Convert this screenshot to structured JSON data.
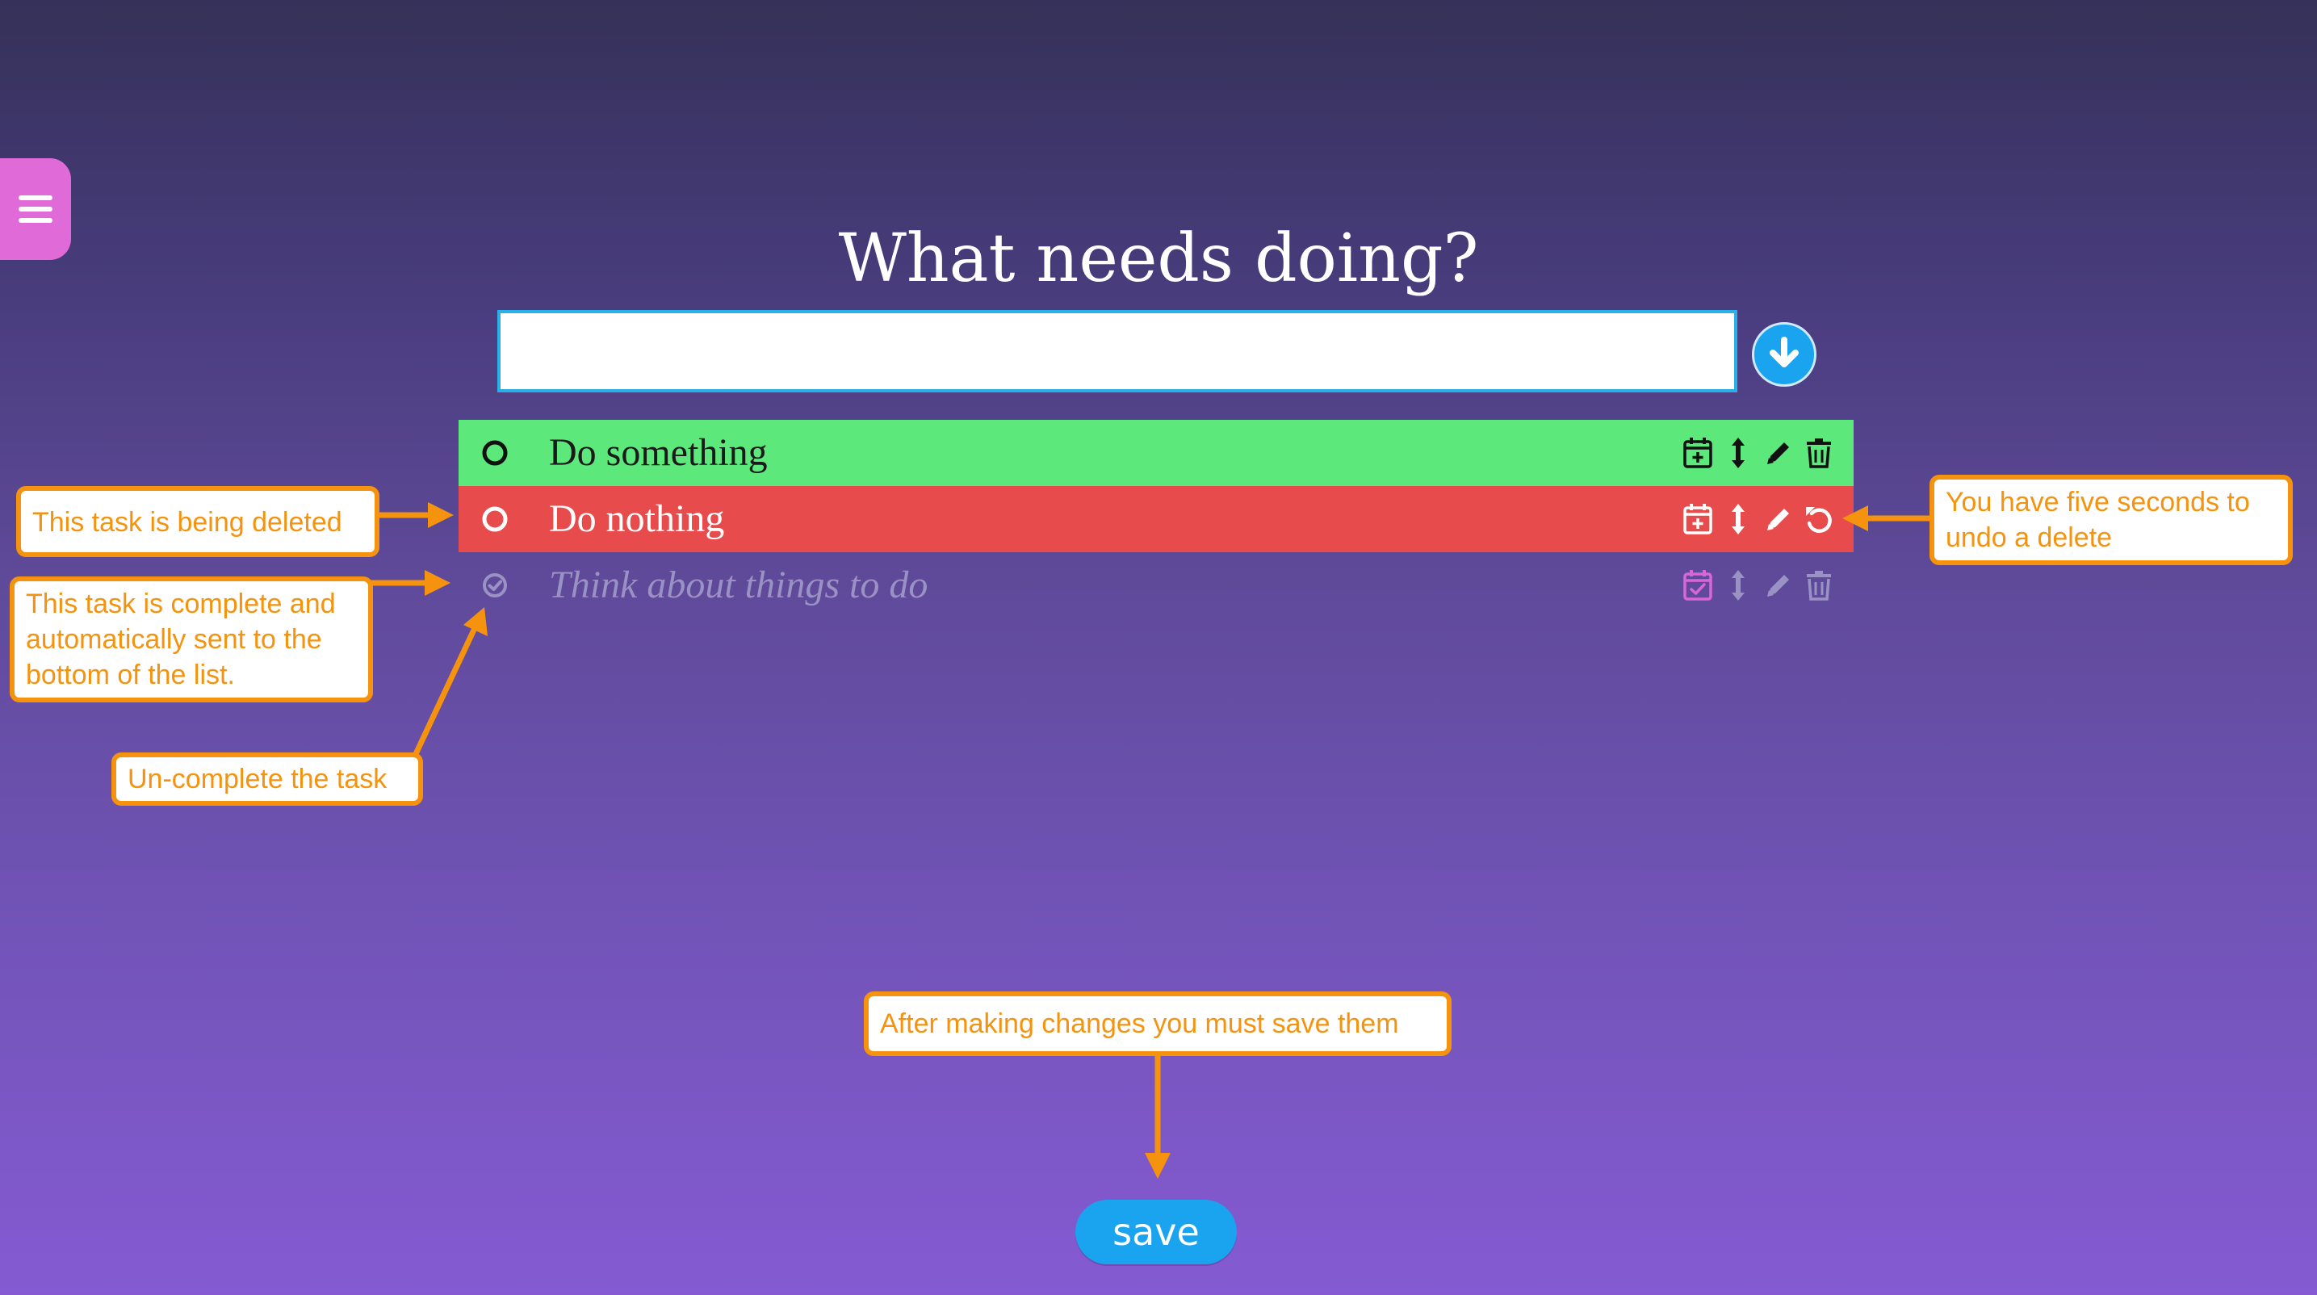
{
  "menu": {
    "icon": "hamburger-menu-icon"
  },
  "header": {
    "title": "What needs doing?"
  },
  "new_task": {
    "value": "",
    "placeholder": "",
    "submit_icon": "arrow-down-circle-icon"
  },
  "tasks": [
    {
      "text": "Do something",
      "state": "active",
      "icons": [
        "calendar-plus-icon",
        "drag-handle-icon",
        "pencil-icon",
        "trash-icon"
      ]
    },
    {
      "text": "Do nothing",
      "state": "deleting",
      "icons": [
        "calendar-plus-icon",
        "drag-handle-icon",
        "pencil-icon",
        "undo-icon"
      ]
    },
    {
      "text": "Think about things to do",
      "state": "completed",
      "icons": [
        "calendar-check-icon",
        "drag-handle-icon",
        "pencil-icon",
        "trash-icon"
      ]
    }
  ],
  "callouts": {
    "deleting": "This task is being deleted",
    "completed": "This task is complete and automatically sent to the bottom of the list.",
    "uncomplete": "Un-complete the task",
    "undo": "You have five seconds to undo a delete",
    "save_hint": "After making changes you must save them"
  },
  "save": {
    "label": "save"
  },
  "colors": {
    "active_row": "#5de87c",
    "deleting_row": "#e74b4b",
    "accent_blue": "#1aa3ee",
    "menu_pink": "#e06ad8",
    "callout_orange": "#f5930e"
  }
}
